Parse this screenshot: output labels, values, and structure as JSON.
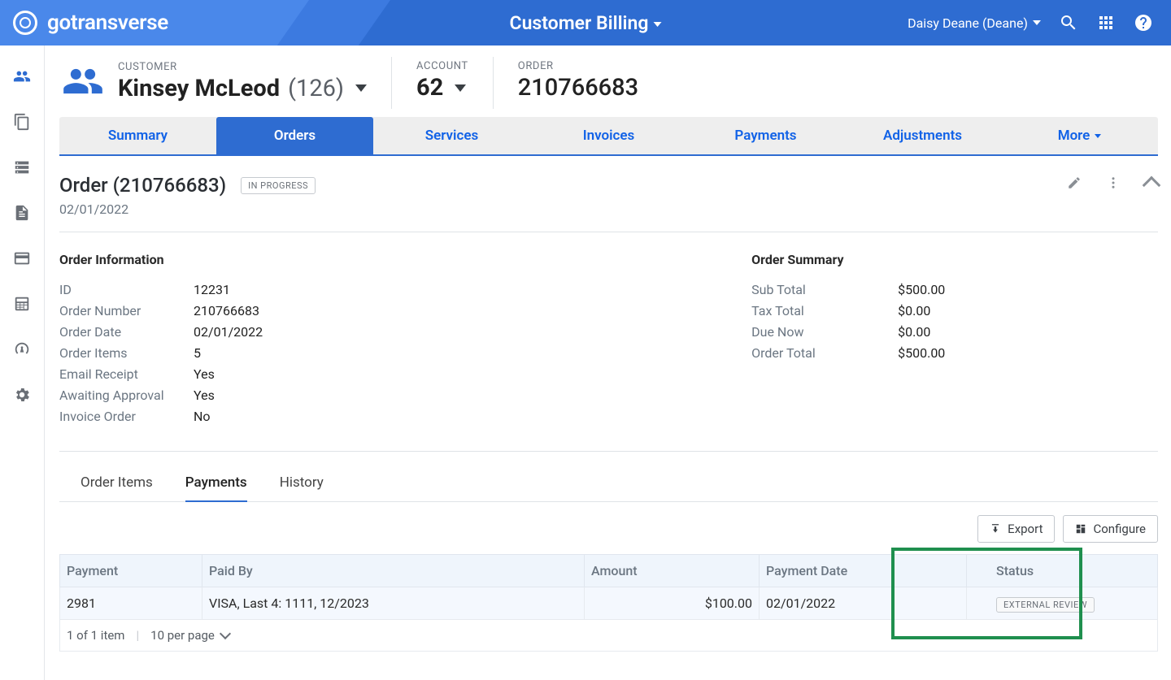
{
  "header": {
    "brand": "gotransverse",
    "title": "Customer Billing",
    "user": "Daisy Deane (Deane)"
  },
  "context": {
    "customer_label": "CUSTOMER",
    "customer_name": "Kinsey McLeod",
    "customer_sub": "(126)",
    "account_label": "ACCOUNT",
    "account_value": "62",
    "order_label": "ORDER",
    "order_value": "210766683"
  },
  "main_tabs": {
    "summary": "Summary",
    "orders": "Orders",
    "services": "Services",
    "invoices": "Invoices",
    "payments": "Payments",
    "adjustments": "Adjustments",
    "more": "More"
  },
  "order_header": {
    "title": "Order (210766683)",
    "status": "IN PROGRESS",
    "date": "02/01/2022"
  },
  "order_info": {
    "head": "Order Information",
    "rows": [
      {
        "k": "ID",
        "v": "12231"
      },
      {
        "k": "Order Number",
        "v": "210766683"
      },
      {
        "k": "Order Date",
        "v": "02/01/2022"
      },
      {
        "k": "Order Items",
        "v": "5"
      },
      {
        "k": "Email Receipt",
        "v": "Yes"
      },
      {
        "k": "Awaiting Approval",
        "v": "Yes"
      },
      {
        "k": "Invoice Order",
        "v": "No"
      }
    ]
  },
  "order_summary": {
    "head": "Order Summary",
    "rows": [
      {
        "k": "Sub Total",
        "v": "$500.00"
      },
      {
        "k": "Tax Total",
        "v": "$0.00"
      },
      {
        "k": "Due Now",
        "v": "$0.00"
      },
      {
        "k": "Order Total",
        "v": "$500.00"
      }
    ]
  },
  "subtabs": {
    "items": "Order Items",
    "payments": "Payments",
    "history": "History"
  },
  "toolbar": {
    "export": "Export",
    "configure": "Configure"
  },
  "table": {
    "headers": {
      "payment": "Payment",
      "paid_by": "Paid By",
      "amount": "Amount",
      "payment_date": "Payment Date",
      "status": "Status"
    },
    "row": {
      "payment": "2981",
      "paid_by": "VISA, Last 4: 1111, 12/2023",
      "amount": "$100.00",
      "payment_date": "02/01/2022",
      "status": "EXTERNAL REVIEW"
    },
    "footer": {
      "count": "1 of 1 item",
      "per_page": "10 per page"
    }
  }
}
